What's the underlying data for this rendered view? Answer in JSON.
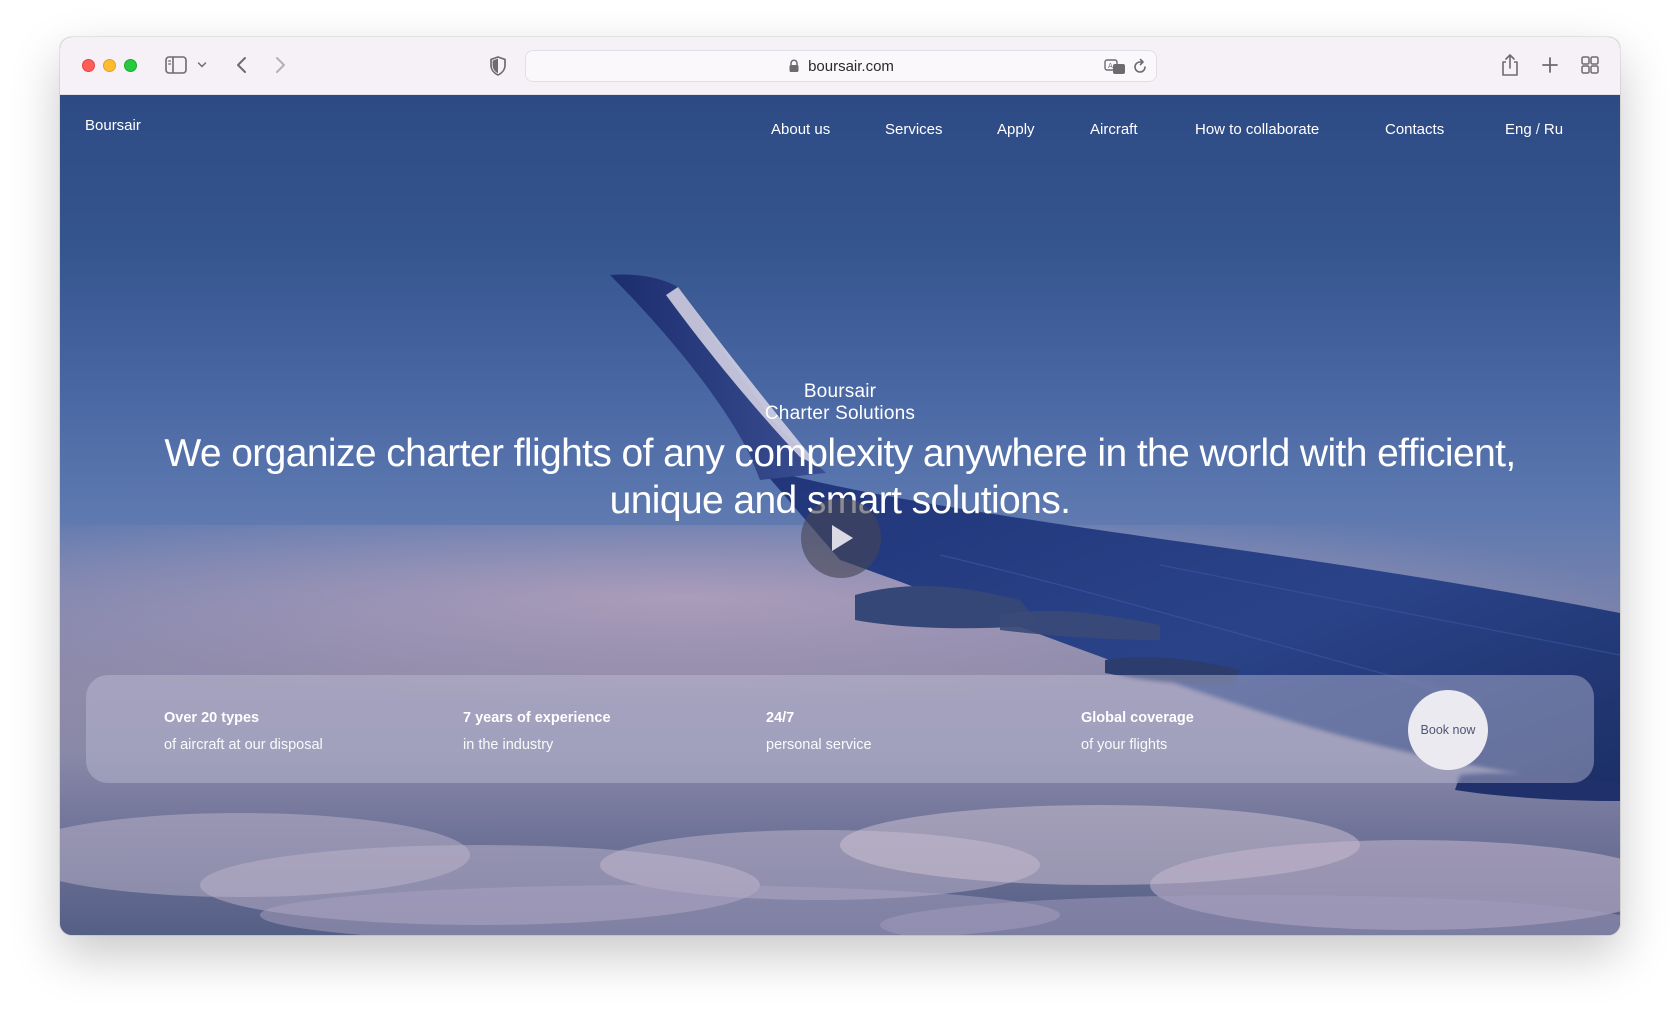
{
  "browser": {
    "url": "boursair.com",
    "icons": [
      "sidebar-toggle-icon",
      "chevron-down-icon",
      "back-arrow-icon",
      "forward-arrow-icon",
      "shield-icon",
      "lock-icon",
      "translate-icon",
      "reload-icon",
      "share-icon",
      "plus-icon",
      "tab-overview-icon"
    ]
  },
  "site": {
    "logo": "Boursair",
    "nav": [
      "About us",
      "Services",
      "Apply",
      "Aircraft",
      "How to collaborate",
      "Contacts"
    ],
    "lang": {
      "eng": "Eng",
      "separator": "/",
      "ru": "Ru"
    }
  },
  "hero": {
    "brand_line1": "Boursair",
    "brand_line2": "Charter Solutions",
    "headline": "We organize charter flights of any complexity anywhere in the world with efficient, unique and smart solutions.",
    "play_icon": "play-icon"
  },
  "stats": [
    {
      "title": "Over 20 types",
      "subtitle": "of aircraft at our disposal"
    },
    {
      "title": "7 years of experience",
      "subtitle": "in the industry"
    },
    {
      "title": "24/7",
      "subtitle": "personal service"
    },
    {
      "title": "Global coverage",
      "subtitle": "of your flights"
    }
  ],
  "cta": {
    "book_now": "Book now"
  },
  "colors": {
    "sky_top": "#2d4a84",
    "sky_horizon": "#8f8aa9",
    "wing": "#1f3470",
    "chrome_bg": "#f6f1f7",
    "cta_bg": "#eceaf1",
    "cta_text": "#4e5675"
  }
}
